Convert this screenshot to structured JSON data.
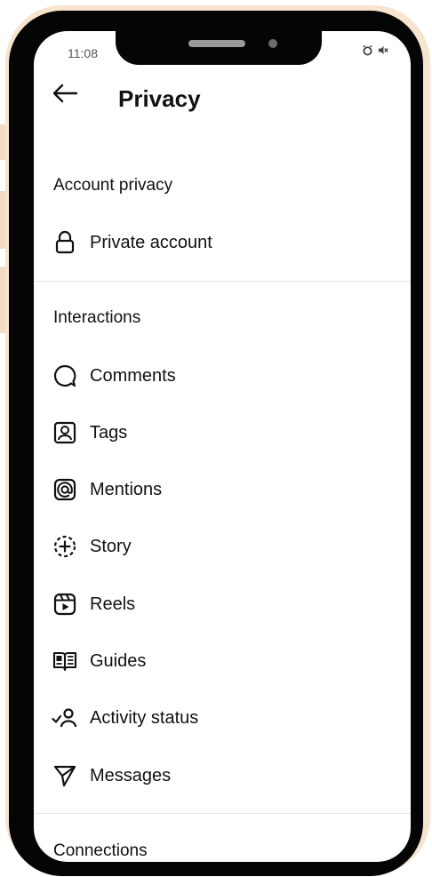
{
  "status_bar": {
    "time": "11:08",
    "icons": [
      "alarm-icon",
      "mute-icon"
    ]
  },
  "header": {
    "title": "Privacy",
    "back_icon": "arrow-left-icon"
  },
  "sections": {
    "account_privacy": {
      "title": "Account privacy",
      "items": [
        {
          "label": "Private account",
          "icon": "lock-icon"
        }
      ]
    },
    "interactions": {
      "title": "Interactions",
      "items": [
        {
          "label": "Comments",
          "icon": "comment-icon"
        },
        {
          "label": "Tags",
          "icon": "tag-person-icon"
        },
        {
          "label": "Mentions",
          "icon": "at-sign-icon"
        },
        {
          "label": "Story",
          "icon": "story-add-icon"
        },
        {
          "label": "Reels",
          "icon": "reels-icon"
        },
        {
          "label": "Guides",
          "icon": "guides-book-icon"
        },
        {
          "label": "Activity status",
          "icon": "activity-status-icon"
        },
        {
          "label": "Messages",
          "icon": "send-icon"
        }
      ]
    },
    "connections": {
      "title": "Connections"
    }
  }
}
